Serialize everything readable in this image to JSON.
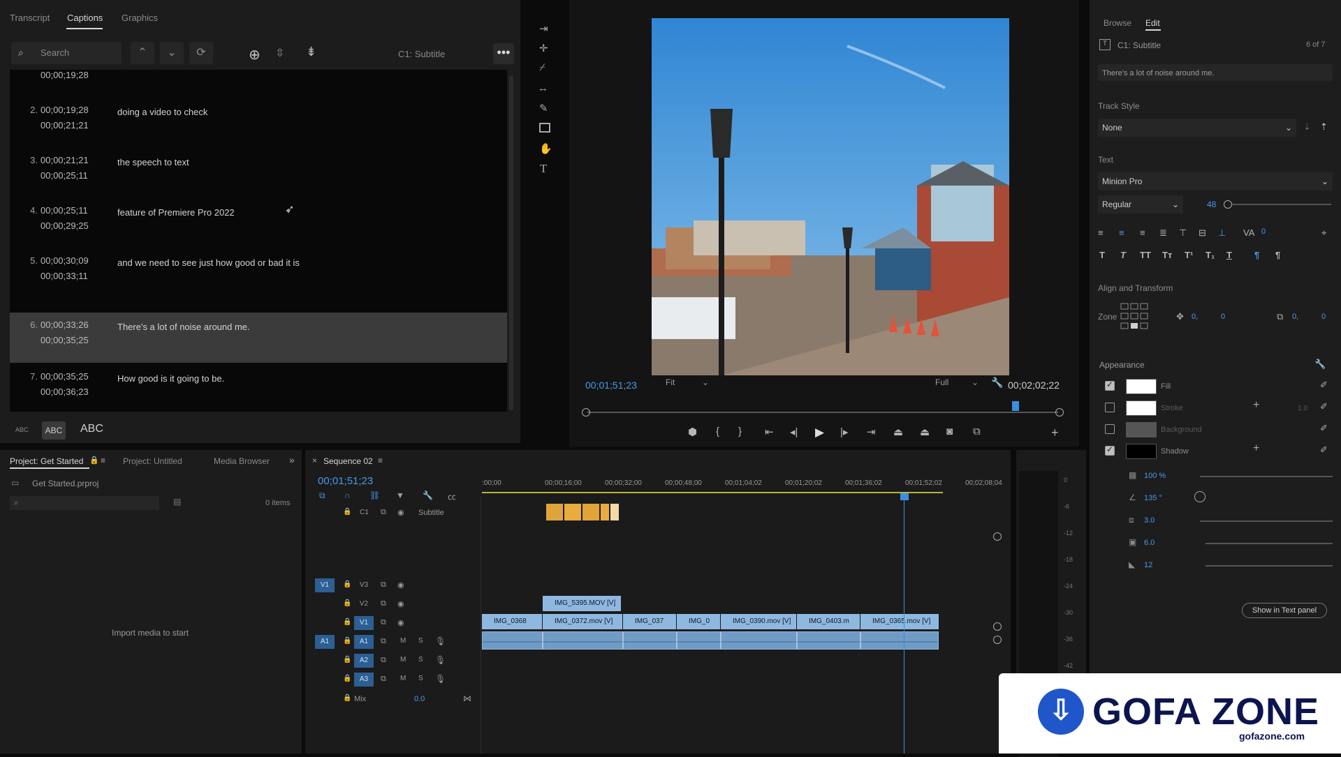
{
  "captions": {
    "tabs": [
      "Transcript",
      "Captions",
      "Graphics"
    ],
    "active_tab": "Captions",
    "search_placeholder": "Search",
    "track_label": "C1: Subtitle",
    "first_time": "00;00;19;28",
    "rows": [
      {
        "n": "2.",
        "start": "00;00;19;28",
        "end": "00;00;21;21",
        "text": "doing a video to check"
      },
      {
        "n": "3.",
        "start": "00;00;21;21",
        "end": "00;00;25;11",
        "text": "the speech to text"
      },
      {
        "n": "4.",
        "start": "00;00;25;11",
        "end": "00;00;29;25",
        "text": "feature of Premiere Pro 2022"
      },
      {
        "n": "5.",
        "start": "00;00;30;09",
        "end": "00;00;33;11",
        "text": "and we need to see just how good or bad it is"
      },
      {
        "n": "6.",
        "start": "00;00;33;26",
        "end": "00;00;35;25",
        "text": "There's a lot of noise around me."
      },
      {
        "n": "7.",
        "start": "00;00;35;25",
        "end": "00;00;36;23",
        "text": "How good is it going to be."
      }
    ],
    "case_buttons": [
      "ABC",
      "ABC",
      "ABC"
    ]
  },
  "program": {
    "current_time": "00;01;51;23",
    "fit": "Fit",
    "quality": "Full",
    "duration": "00;02;02;22",
    "playhead_fraction": 0.91
  },
  "essential_graphics": {
    "tabs": [
      "Browse",
      "Edit"
    ],
    "layer_name": "C1: Subtitle",
    "layer_count": "6 of 7",
    "caption_text": "There's a lot of noise around me.",
    "track_style_label": "Track Style",
    "track_style": "None",
    "text_label": "Text",
    "font": "Minion Pro",
    "font_style": "Regular",
    "font_size": "48",
    "tracking": "0",
    "align_label": "Align and Transform",
    "zone_label": "Zone",
    "pos_x": "0,",
    "pos_y": "0",
    "scale_x": "0,",
    "scale_y": "0",
    "appearance_label": "Appearance",
    "fill": "Fill",
    "stroke": "Stroke",
    "stroke_width": "1.0",
    "background": "Background",
    "shadow": "Shadow",
    "opacity": "100 %",
    "angle": "135 °",
    "distance": "3.0",
    "size": "6.0",
    "blur": "12",
    "show_text_panel": "Show in Text panel",
    "colors": {
      "fill": "#ffffff",
      "stroke": "#ffffff",
      "background": "#555555",
      "shadow": "#000000"
    }
  },
  "project": {
    "tabs": [
      "Project: Get Started",
      "Project: Untitled",
      "Media Browser"
    ],
    "file": "Get Started.prproj",
    "items": "0 items",
    "empty_hint": "Import media to start"
  },
  "timeline": {
    "sequence": "Sequence 02",
    "timecode": "00;01;51;23",
    "ruler": [
      ":00;00",
      "00;00;16;00",
      "00;00;32;00",
      "00;00;48;00",
      "00;01;04;02",
      "00;01;20;02",
      "00;01;36;02",
      "00;01;52;02",
      "00;02;08;04"
    ],
    "subtitle_track": "Subtitle",
    "subtitle_track_id": "C1",
    "tracks_video": [
      "V3",
      "V2",
      "V1"
    ],
    "tracks_audio": [
      "A1",
      "A2",
      "A3"
    ],
    "mix_label": "Mix",
    "mix_value": "0.0",
    "v2_clips": [
      "IMG_5395.MOV [V]"
    ],
    "v1_clips": [
      "IMG_0368",
      "IMG_0372.mov [V]",
      "IMG_037",
      "IMG_0",
      "IMG_0390.mov [V]",
      "IMG_0403.m",
      "IMG_0365.mov [V]"
    ],
    "meter_scale": [
      "0",
      "-6",
      "-12",
      "-18",
      "-24",
      "-30",
      "-36",
      "-42"
    ]
  },
  "logo": {
    "brand": "GOFA ZONE",
    "domain": "gofazone.com"
  }
}
